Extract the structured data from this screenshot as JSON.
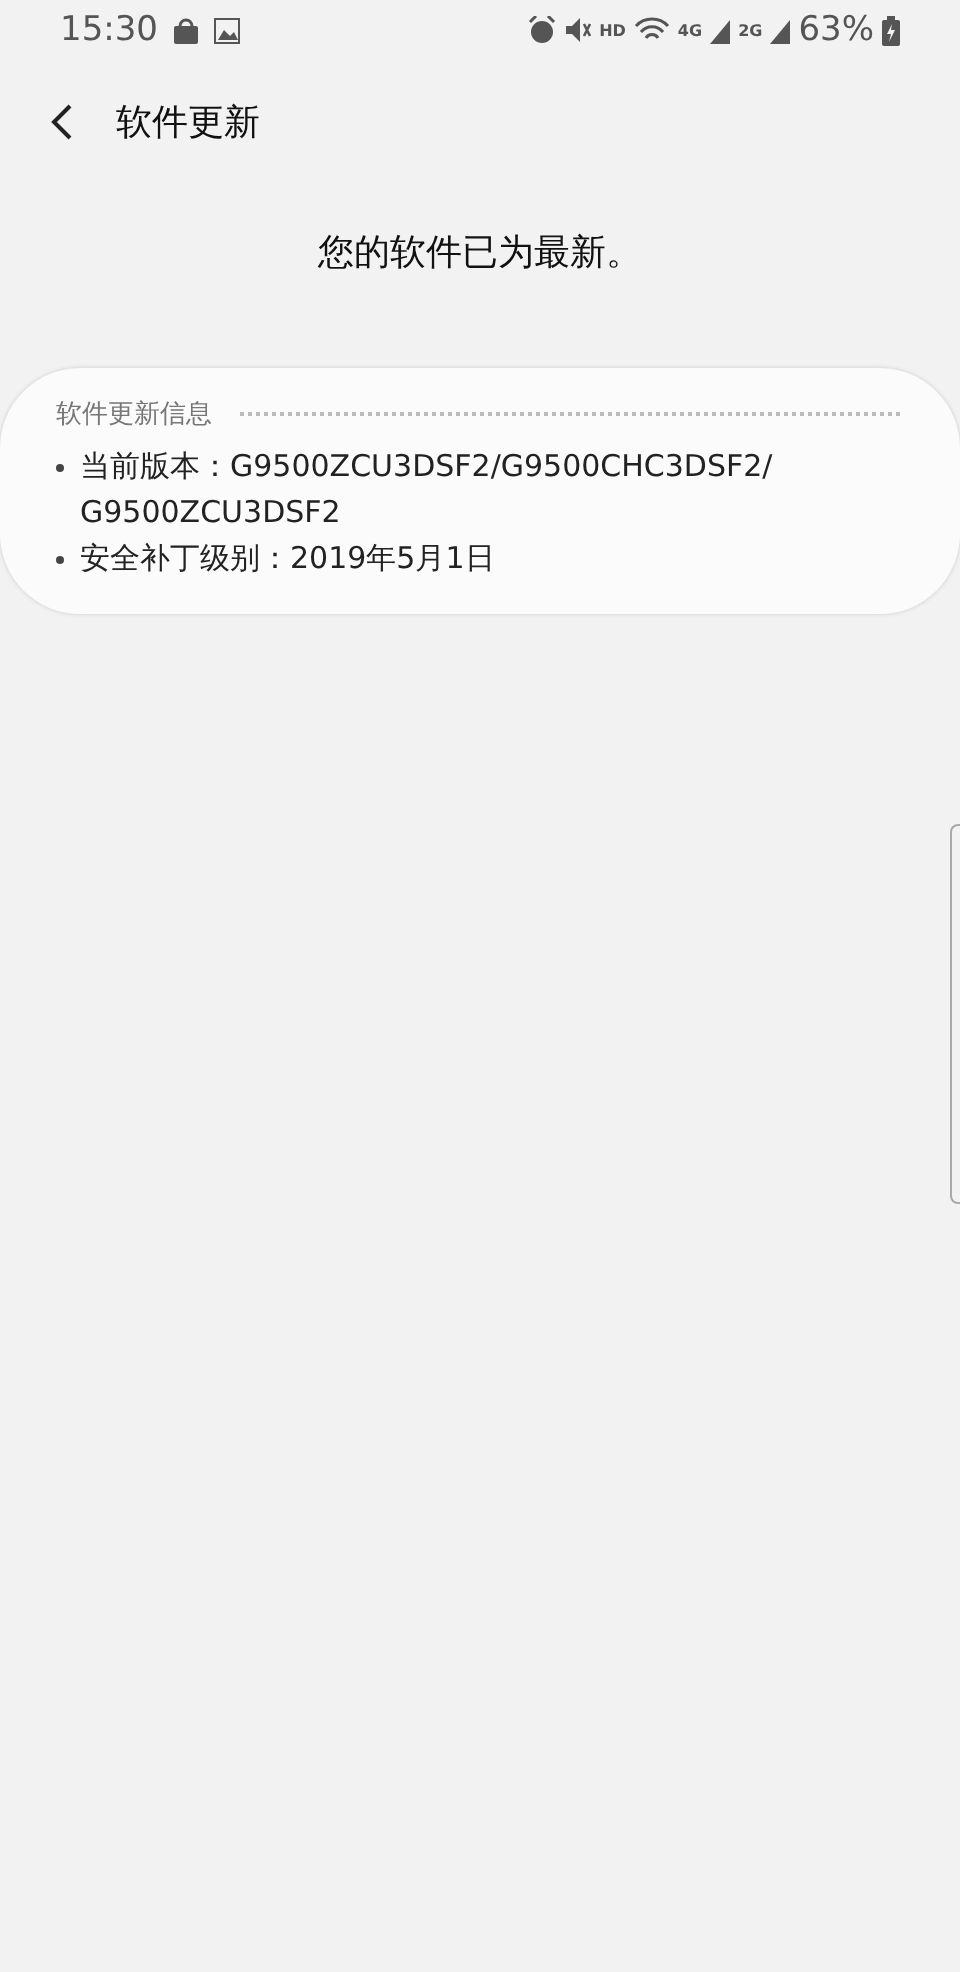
{
  "status_bar": {
    "time": "15:30",
    "hd": "HD",
    "network_1": "4G",
    "network_2": "2G",
    "battery": "63%"
  },
  "header": {
    "title": "软件更新"
  },
  "message": "您的软件已为最新。",
  "info_card": {
    "title": "软件更新信息",
    "items": [
      {
        "label": "当前版本：",
        "value": "G9500ZCU3DSF2/G9500CHC3DSF2/ G9500ZCU3DSF2"
      },
      {
        "label": "安全补丁级别：",
        "value": "2019年5月1日"
      }
    ]
  }
}
